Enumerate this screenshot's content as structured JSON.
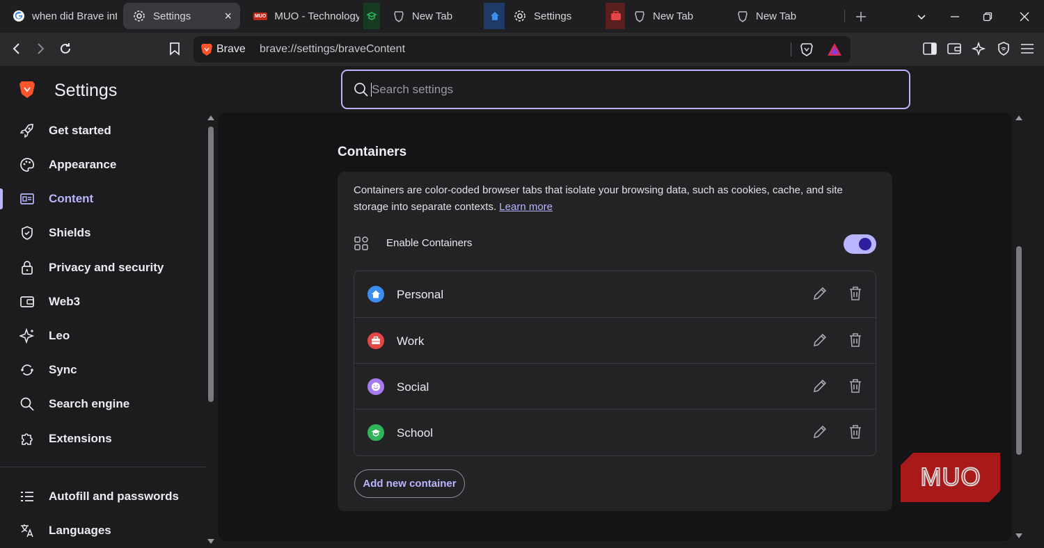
{
  "tabs": [
    {
      "title": "when did Brave int",
      "icon": "google-icon"
    },
    {
      "title": "Settings",
      "icon": "gear-icon",
      "active": true,
      "close": "×"
    },
    {
      "title": "MUO - Technology",
      "icon": "muo-icon"
    },
    {
      "title": "New Tab",
      "icon": "brave-icon",
      "container": "school-icon"
    },
    {
      "title": "Settings",
      "icon": "gear-icon",
      "container": "personal-icon"
    },
    {
      "title": "New Tab",
      "icon": "brave-icon",
      "container": "work-icon"
    },
    {
      "title": "New Tab",
      "icon": "brave-icon"
    }
  ],
  "tab_muo_badge": "MUO",
  "toolbar": {
    "site_label": "Brave",
    "url": "brave://settings/braveContent"
  },
  "sidebar": {
    "title": "Settings",
    "items": [
      {
        "label": "Get started",
        "icon": "rocket-icon"
      },
      {
        "label": "Appearance",
        "icon": "palette-icon"
      },
      {
        "label": "Content",
        "icon": "content-icon",
        "active": true
      },
      {
        "label": "Shields",
        "icon": "shield-icon"
      },
      {
        "label": "Privacy and security",
        "icon": "lock-icon"
      },
      {
        "label": "Web3",
        "icon": "wallet-icon"
      },
      {
        "label": "Leo",
        "icon": "leo-icon"
      },
      {
        "label": "Sync",
        "icon": "sync-icon"
      },
      {
        "label": "Search engine",
        "icon": "search-icon"
      },
      {
        "label": "Extensions",
        "icon": "puzzle-icon"
      },
      {
        "label": "Autofill and passwords",
        "icon": "list-icon"
      },
      {
        "label": "Languages",
        "icon": "translate-icon"
      }
    ]
  },
  "search": {
    "placeholder": "Search settings"
  },
  "containers": {
    "title": "Containers",
    "description": "Containers are color-coded browser tabs that isolate your browsing data, such as cookies, cache, and site storage into separate contexts.",
    "learn_more": "Learn more",
    "enable_label": "Enable Containers",
    "enabled": true,
    "items": [
      {
        "name": "Personal",
        "color": "#3b8ef0",
        "icon": "home-icon"
      },
      {
        "name": "Work",
        "color": "#e64545",
        "icon": "briefcase-icon"
      },
      {
        "name": "Social",
        "color": "#a77bf0",
        "icon": "smile-icon"
      },
      {
        "name": "School",
        "color": "#2fb45a",
        "icon": "graduation-cap-icon"
      }
    ],
    "add_button": "Add new container"
  },
  "watermark": "MUO",
  "colors": {
    "accent": "#b9b6ff",
    "brand": "#fb542b",
    "background": "#1c1c1e"
  }
}
